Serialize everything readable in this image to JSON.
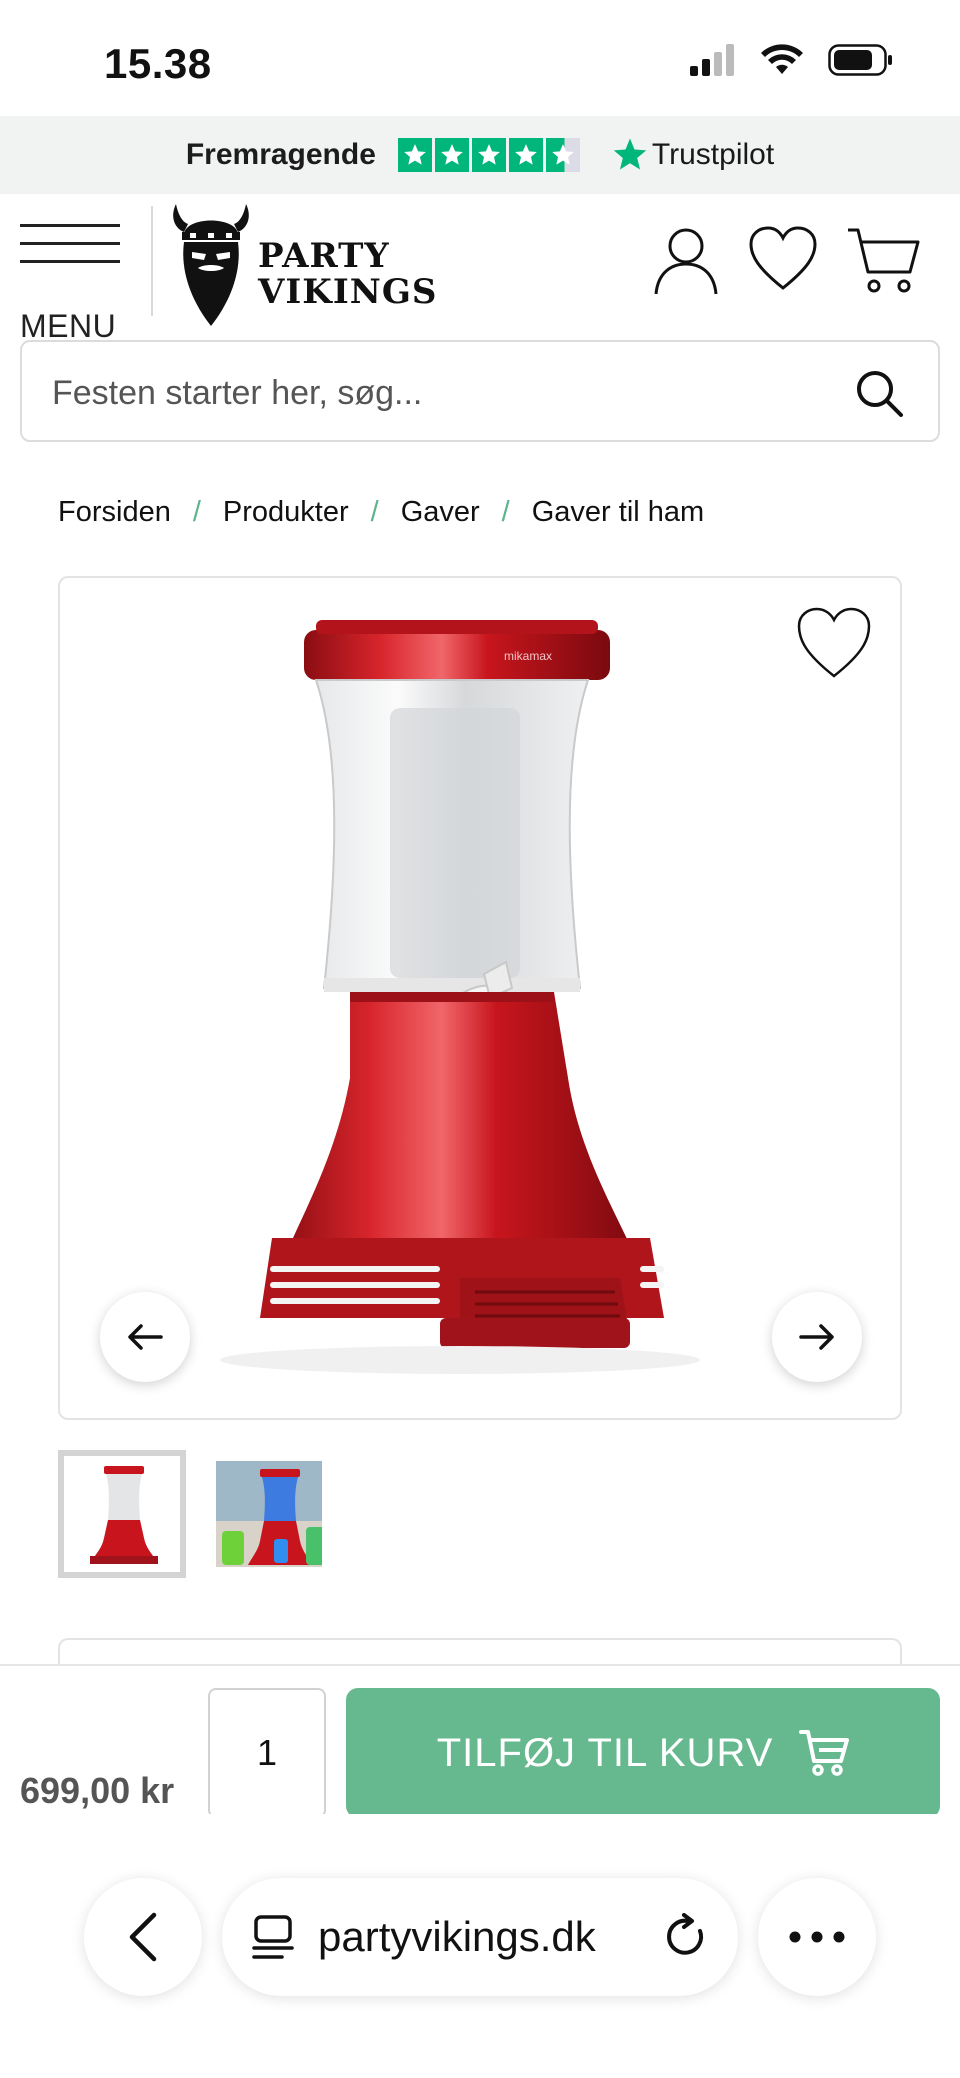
{
  "status_bar": {
    "time": "15.38"
  },
  "trustpilot": {
    "label": "Fremragende",
    "brand": "Trustpilot",
    "stars": 4.5
  },
  "header": {
    "menu_label": "MENU",
    "logo_line1": "PARTY",
    "logo_line2": "VIKINGS"
  },
  "search": {
    "placeholder": "Festen starter her, søg..."
  },
  "breadcrumb": [
    "Forsiden",
    "Produkter",
    "Gaver",
    "Gaver til ham"
  ],
  "product": {
    "brand_mark": "mikamax",
    "price": "699,00 kr",
    "quantity": "1",
    "add_to_cart": "TILFØJ TIL KURV"
  },
  "browser": {
    "url": "partyvikings.dk"
  },
  "colors": {
    "accent": "#66b88e",
    "trustpilot": "#00b67a",
    "product_red": "#c8151d"
  }
}
